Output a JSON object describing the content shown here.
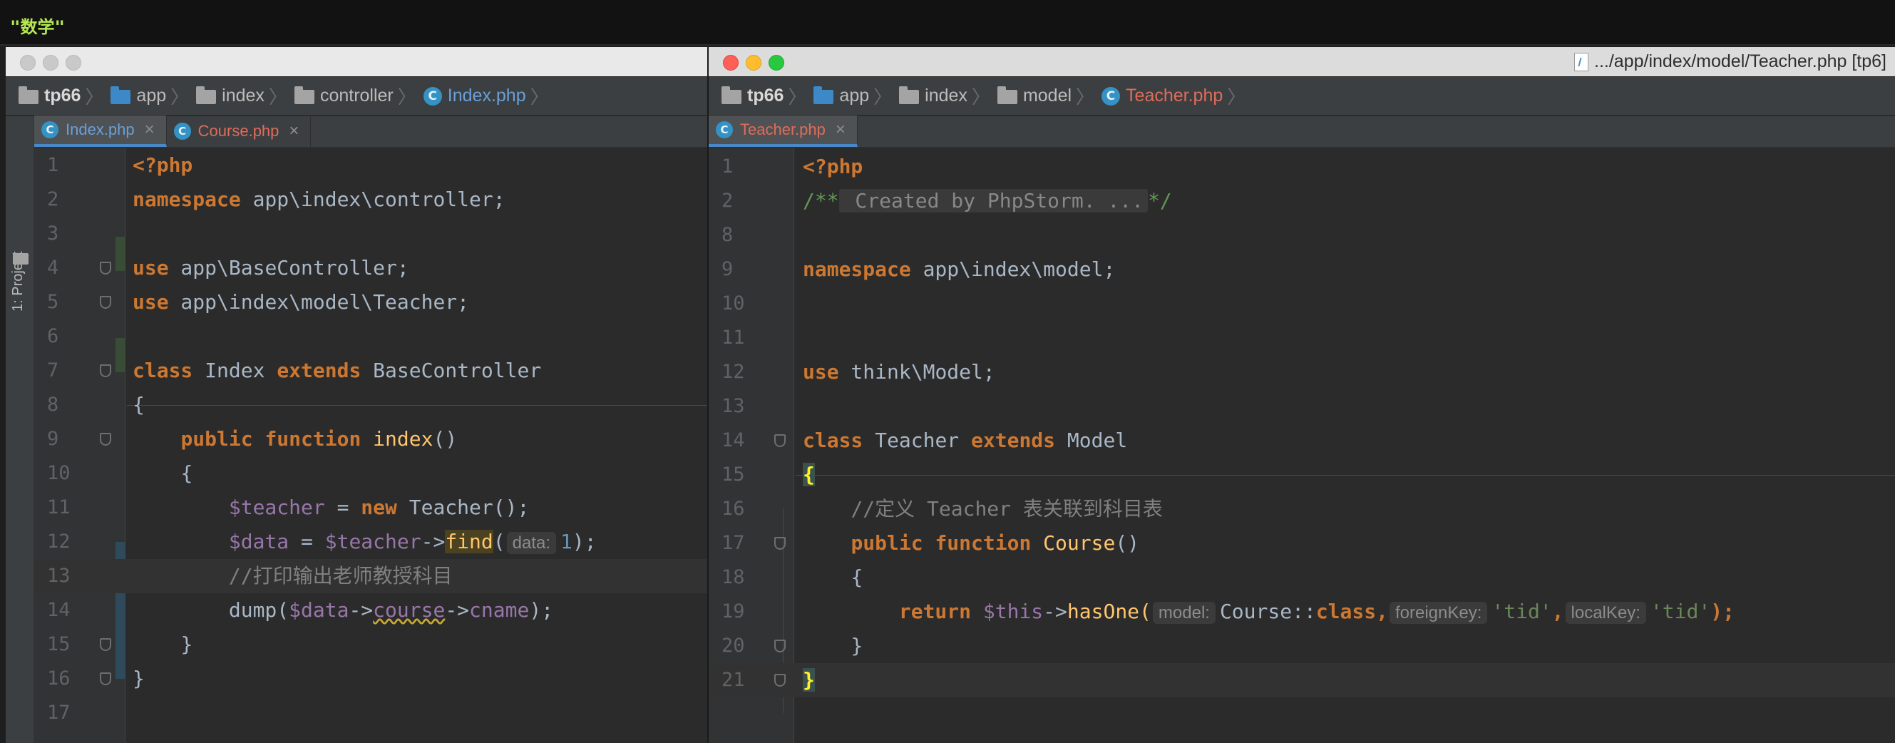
{
  "console_output": "\"数学\"",
  "left_window": {
    "breadcrumb": [
      "tp66",
      "app",
      "index",
      "controller",
      "Index.php"
    ],
    "tabs": [
      {
        "label": "Index.php",
        "active": true
      },
      {
        "label": "Course.php",
        "active": false
      }
    ],
    "sidebar_label": "1: Project",
    "line_numbers": [
      "1",
      "2",
      "3",
      "4",
      "5",
      "6",
      "7",
      "8",
      "9",
      "10",
      "11",
      "12",
      "13",
      "14",
      "15",
      "16",
      "17"
    ],
    "code": {
      "l1": "<?php",
      "l2_kw": "namespace",
      "l2_rest": " app\\index\\controller;",
      "l4_kw": "use",
      "l4_rest": " app\\BaseController;",
      "l5_kw": "use",
      "l5_rest": " app\\index\\model\\Teacher;",
      "l7_kw1": "class",
      "l7_name": " Index ",
      "l7_kw2": "extends",
      "l7_rest": " BaseController",
      "l8": "{",
      "l9_kw1": "public",
      "l9_kw2": "function",
      "l9_fn": "index",
      "l9_rest": "()",
      "l10": "{",
      "l11_var": "$teacher",
      "l11_mid": " = ",
      "l11_kw": "new",
      "l11_rest": " Teacher();",
      "l12_var1": "$data",
      "l12_mid1": " = ",
      "l12_var2": "$teacher",
      "l12_arrow": "->",
      "l12_fn": "find",
      "l12_paren": "(",
      "l12_hint": "data:",
      "l12_num": "1",
      "l12_end": ");",
      "l13": "//打印输出老师教授科目",
      "l14_fn": "dump(",
      "l14_var": "$data",
      "l14_arrow1": "->",
      "l14_prop1": "course",
      "l14_arrow2": "->",
      "l14_prop2": "cname",
      "l14_end": ");",
      "l15": "}",
      "l16": "}"
    }
  },
  "right_window": {
    "title": ".../app/index/model/Teacher.php [tp6]",
    "breadcrumb": [
      "tp66",
      "app",
      "index",
      "model",
      "Teacher.php"
    ],
    "tabs": [
      {
        "label": "Teacher.php",
        "active": true
      }
    ],
    "line_numbers": [
      "1",
      "2",
      "8",
      "9",
      "10",
      "11",
      "12",
      "13",
      "14",
      "15",
      "16",
      "17",
      "18",
      "19",
      "20",
      "21"
    ],
    "code": {
      "l1": "<?php",
      "l2_open": "/**",
      "l2_fold": " Created by PhpStorm. ...",
      "l2_close": "*/",
      "l9_kw": "namespace",
      "l9_rest": " app\\index\\model;",
      "l12_kw": "use",
      "l12_rest": " think\\Model;",
      "l14_kw1": "class",
      "l14_name": " Teacher ",
      "l14_kw2": "extends",
      "l14_rest": " Model",
      "l15": "{",
      "l16": "//定义 Teacher 表关联到科目表",
      "l17_kw1": "public",
      "l17_kw2": "function",
      "l17_fn": "Course",
      "l17_rest": "()",
      "l18": "{",
      "l19_kw": "return",
      "l19_var": "$this",
      "l19_arrow": "->",
      "l19_fn": "hasOne(",
      "l19_hint1": "model:",
      "l19_cls": "Course::",
      "l19_kw2": "class",
      "l19_comma1": ",",
      "l19_hint2": "foreignKey:",
      "l19_str1": "'tid'",
      "l19_comma2": ",",
      "l19_hint3": "localKey:",
      "l19_str2": "'tid'",
      "l19_end": ");",
      "l20": "}",
      "l21": "}"
    }
  }
}
